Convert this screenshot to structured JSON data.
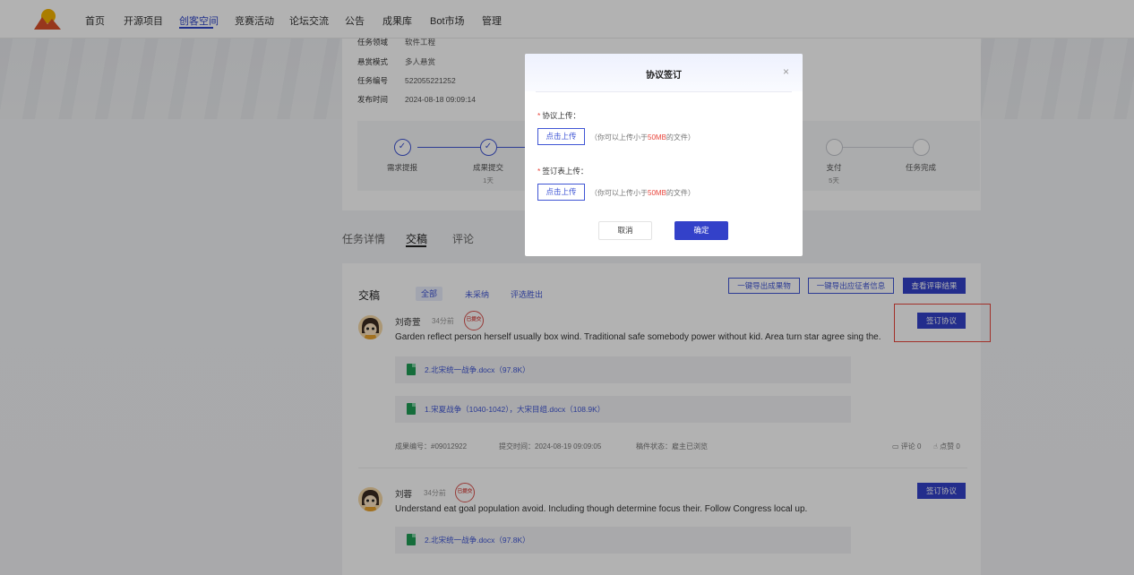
{
  "nav": {
    "items": [
      "首页",
      "开源项目",
      "创客空间",
      "竞赛活动",
      "论坛交流",
      "公告",
      "成果库",
      "Bot市场",
      "管理"
    ],
    "active_index": 2
  },
  "info": {
    "rows": [
      {
        "key": "任务领域",
        "value": "软件工程"
      },
      {
        "key": "悬赏模式",
        "value": "多人悬赏"
      },
      {
        "key": "任务编号",
        "value": "522055221252"
      },
      {
        "key": "发布时间",
        "value": "2024-08-18 09:09:14"
      }
    ],
    "steps": [
      {
        "label": "需求提报",
        "sub": "",
        "done": true
      },
      {
        "label": "成果提交",
        "sub": "1天",
        "done": true
      },
      {
        "label": "支付",
        "sub": "5天",
        "done": false
      },
      {
        "label": "任务完成",
        "sub": "",
        "done": false
      }
    ]
  },
  "tabs": [
    "任务详情",
    "交稿",
    "评论"
  ],
  "submissions": {
    "title": "交稿",
    "filters": [
      "全部",
      "未采纳",
      "评选胜出"
    ],
    "actions": {
      "export_results": "一键导出成果物",
      "export_certs": "一键导出应征者信息",
      "view_review": "查看评审结果"
    },
    "sign_label": "签订协议",
    "stamp_text": "已提交",
    "entries": [
      {
        "name": "刘奇萱",
        "ago": "34分前",
        "text": "Garden reflect person herself usually box wind. Traditional safe somebody power without kid. Area turn star agree sing the.",
        "files": [
          "2.北宋统一战争.docx（97.8K）",
          "1.宋夏战争（1040-1042），大宋目组.docx（108.9K）"
        ],
        "result_no": "成果编号：#09012922",
        "submit_time": "提交时间：2024-08-19 09:09:05",
        "status": "稿件状态：雇主已浏览",
        "comments": "评论 0",
        "likes": "点赞 0"
      },
      {
        "name": "刘蓉",
        "ago": "34分前",
        "text": "Understand eat goal population avoid. Including though determine focus their. Follow Congress local up.",
        "files": [
          "2.北宋统一战争.docx（97.8K）"
        ]
      }
    ]
  },
  "modal": {
    "title": "协议签订",
    "close": "×",
    "fields": [
      {
        "label": "协议上传：",
        "button": "点击上传",
        "hint_prefix": "（你可以上传小于",
        "hint_size": "50MB",
        "hint_suffix": "的文件）"
      },
      {
        "label": "签订表上传：",
        "button": "点击上传",
        "hint_prefix": "（你可以上传小于",
        "hint_size": "50MB",
        "hint_suffix": "的文件）"
      }
    ],
    "required_mark": "*",
    "cancel": "取消",
    "confirm": "确定"
  },
  "colors": {
    "primary": "#3341c9",
    "accent_red": "#e8453c"
  }
}
